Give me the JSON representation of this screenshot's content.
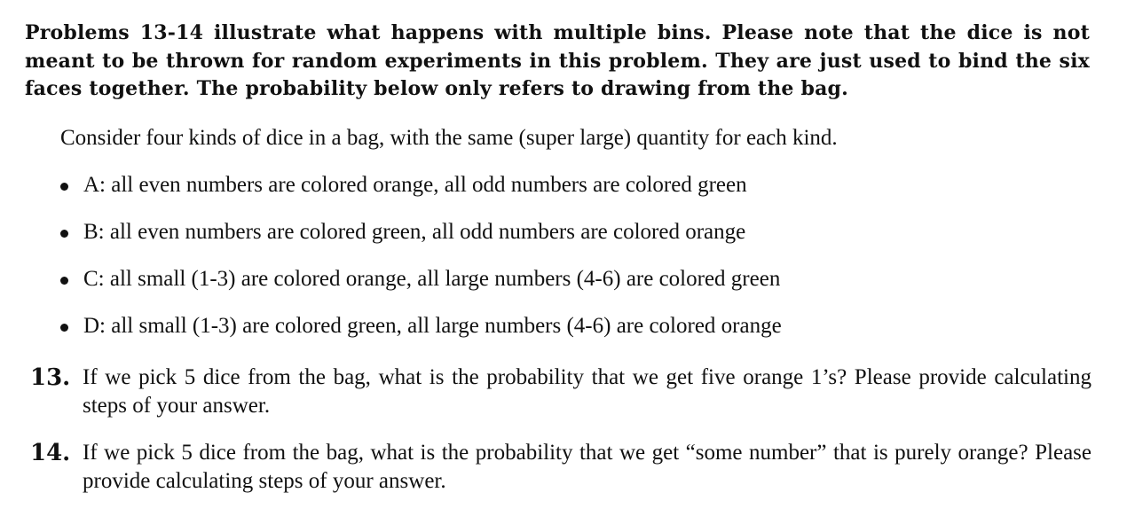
{
  "intro": "Problems 13-14 illustrate what happens with multiple bins. Please note that the dice is not meant to be thrown for random experiments in this problem. They are just used to bind the six faces together. The probability below only refers to drawing from the bag.",
  "consider": "Consider four kinds of dice in a bag, with the same (super large) quantity for each kind.",
  "bullets": [
    "A: all even numbers are colored orange, all odd numbers are colored green",
    "B: all even numbers are colored green, all odd numbers are colored orange",
    "C: all small (1-3) are colored orange, all large numbers (4-6) are colored green",
    "D: all small (1-3) are colored green, all large numbers (4-6) are colored orange"
  ],
  "questions": [
    {
      "number": "13.",
      "text": "If we pick 5 dice from the bag, what is the probability that we get five orange 1’s? Please provide calculating steps of your answer."
    },
    {
      "number": "14.",
      "text": "If we pick 5 dice from the bag, what is the probability that we get “some number” that is purely orange? Please provide calculating steps of your answer."
    }
  ]
}
